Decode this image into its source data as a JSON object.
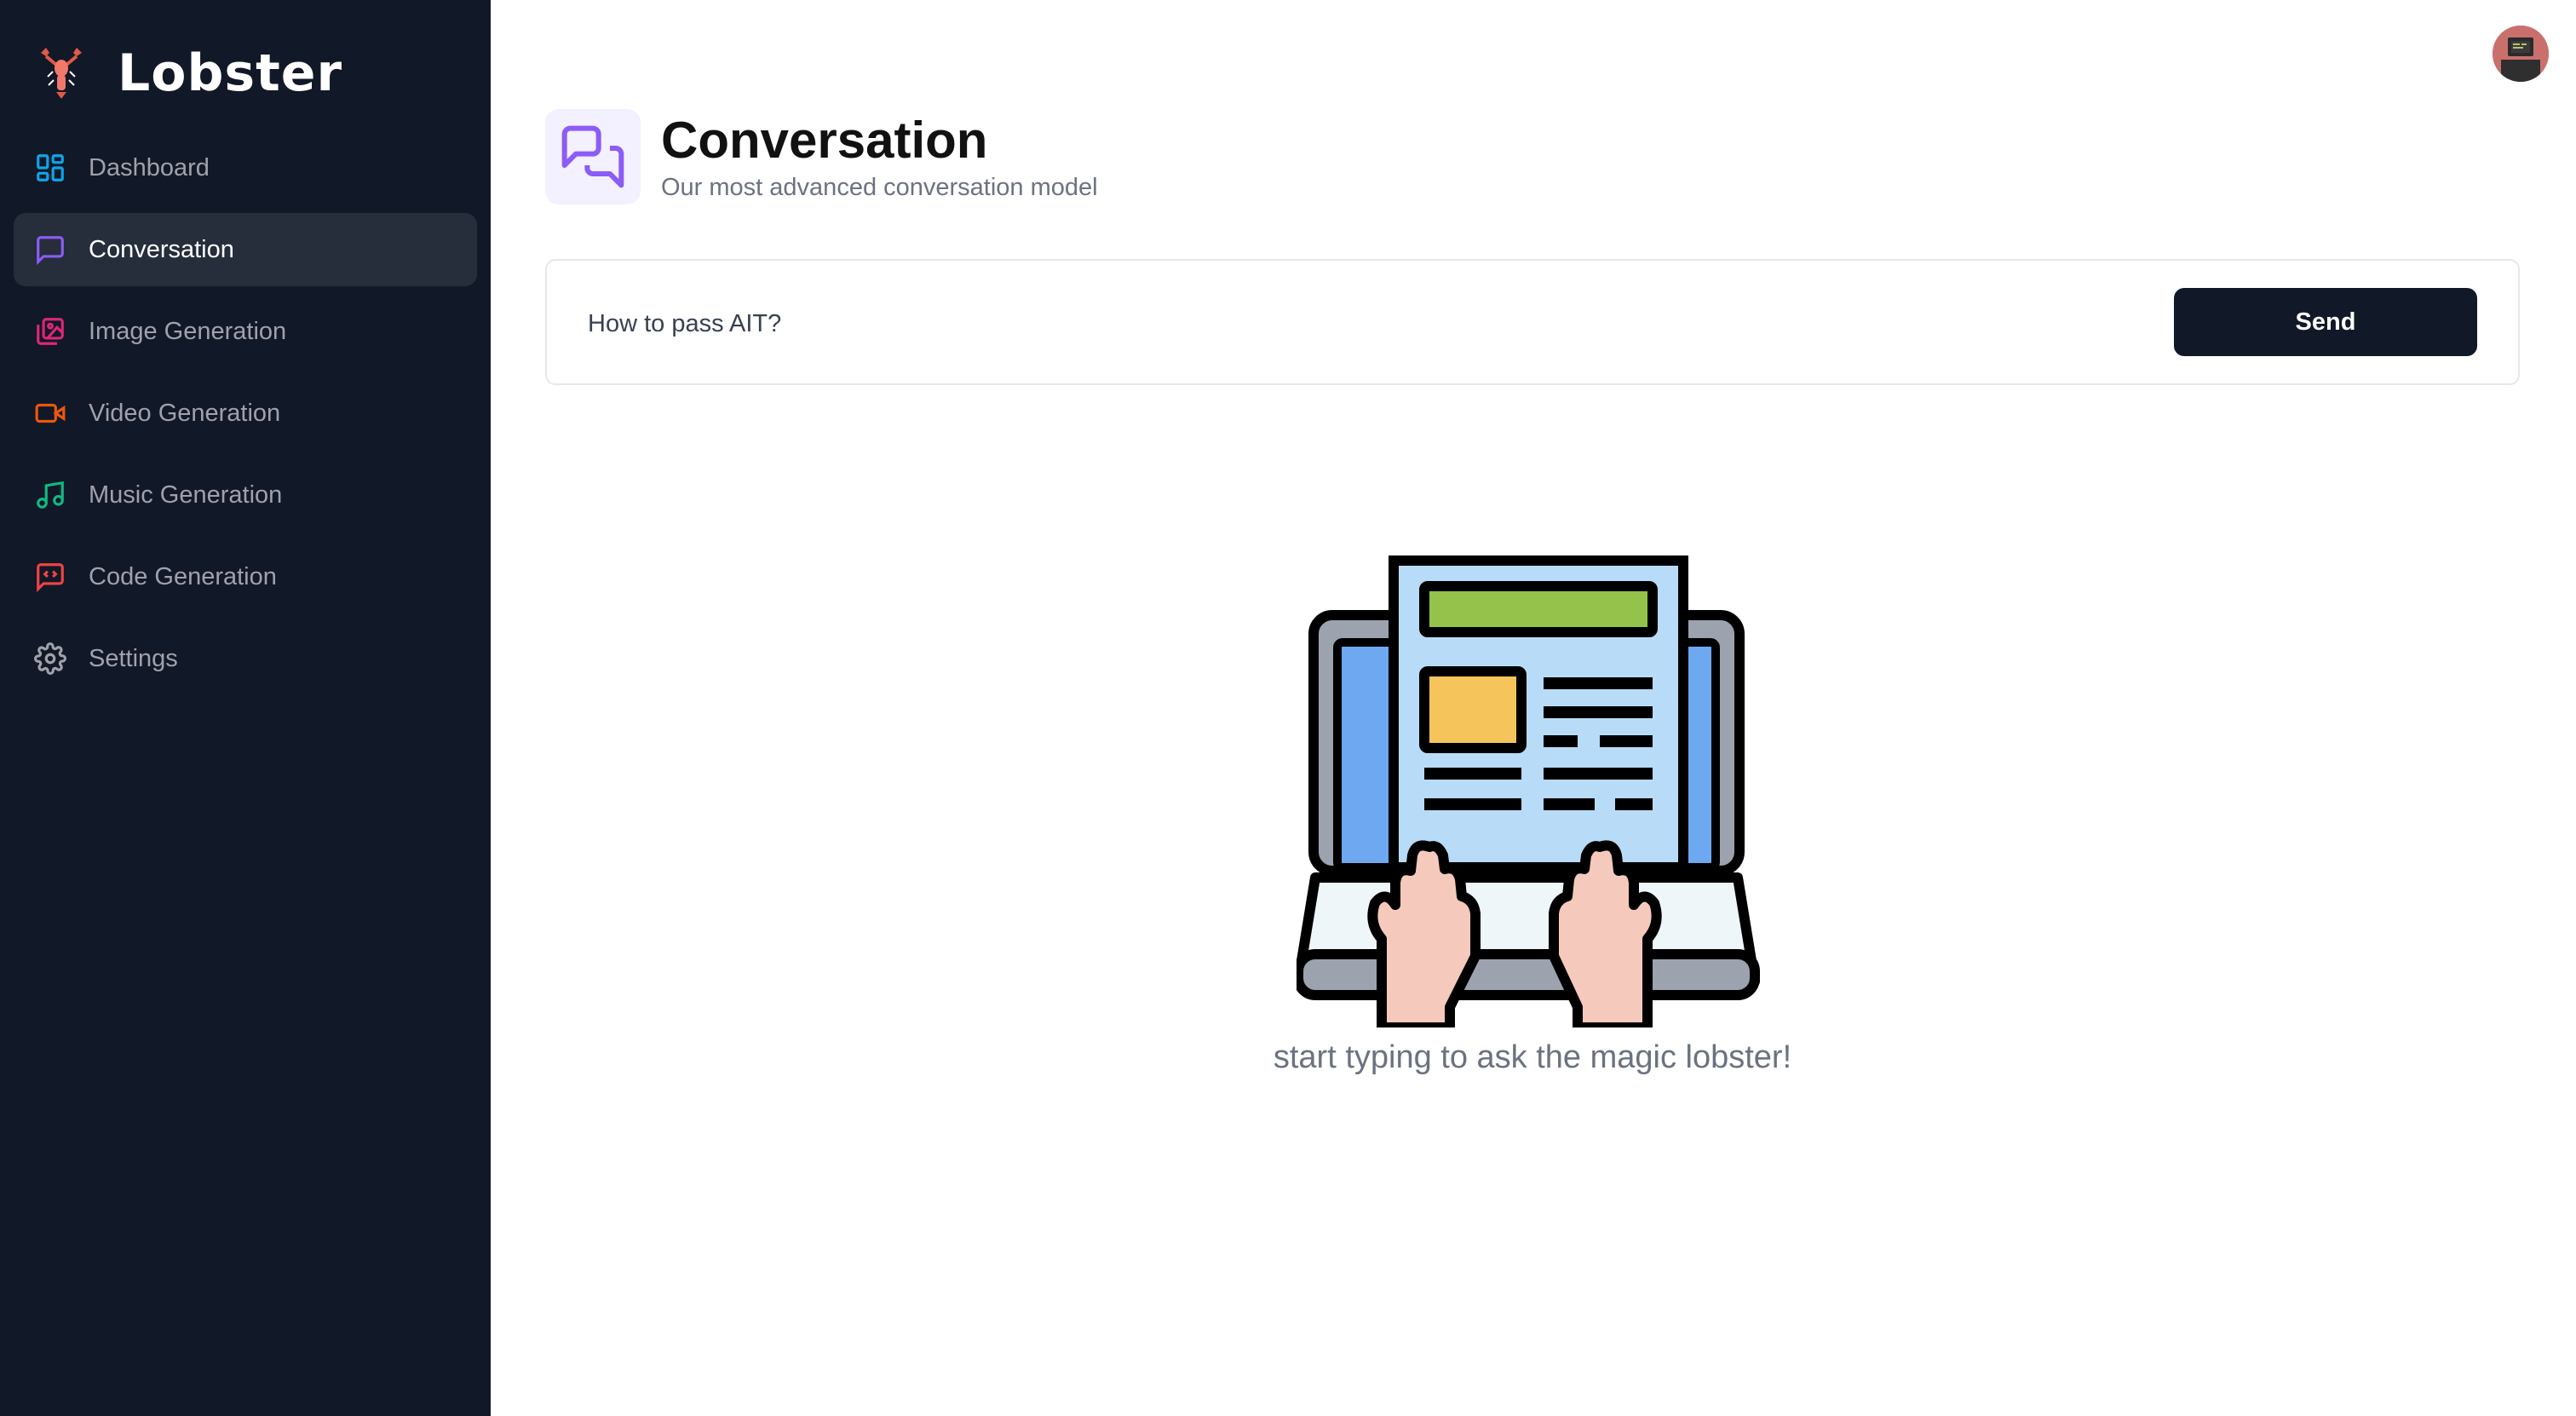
{
  "app": {
    "name": "Lobster"
  },
  "sidebar": {
    "items": [
      {
        "label": "Dashboard",
        "icon": "dashboard-icon",
        "color": "#0ea5e9",
        "active": false
      },
      {
        "label": "Conversation",
        "icon": "message-square-icon",
        "color": "#8b5cf6",
        "active": true
      },
      {
        "label": "Image Generation",
        "icon": "image-icon",
        "color": "#db2777",
        "active": false
      },
      {
        "label": "Video Generation",
        "icon": "video-icon",
        "color": "#ea580c",
        "active": false
      },
      {
        "label": "Music Generation",
        "icon": "music-icon",
        "color": "#10b981",
        "active": false
      },
      {
        "label": "Code Generation",
        "icon": "code-icon",
        "color": "#ef4444",
        "active": false
      },
      {
        "label": "Settings",
        "icon": "gear-icon",
        "color": "#a1a1aa",
        "active": false
      }
    ]
  },
  "header": {
    "title": "Conversation",
    "subtitle": "Our most advanced conversation model",
    "icon": "messages-icon",
    "icon_color": "#8b5cf6"
  },
  "prompt": {
    "value": "How to pass AIT?",
    "send_label": "Send"
  },
  "empty_state": {
    "text": "start typing to ask the magic lobster!"
  },
  "colors": {
    "sidebar_bg": "#111827",
    "active_item_bg": "#262d3b",
    "button_bg": "#111827"
  }
}
